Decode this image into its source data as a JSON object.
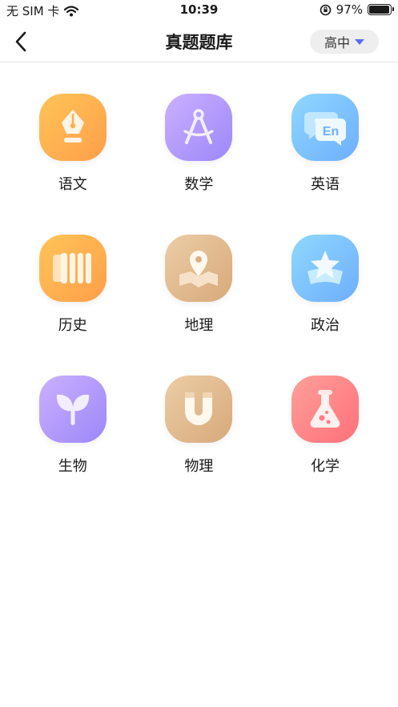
{
  "status_bar": {
    "carrier": "无 SIM 卡",
    "time": "10:39",
    "battery_text": "97%",
    "battery_level": 0.97
  },
  "nav": {
    "title": "真题题库",
    "grade": "高中",
    "accent_color": "#5b6bf0"
  },
  "subjects": [
    {
      "label": "语文",
      "icon": "fountain-pen-icon",
      "colors": [
        "#ffc457",
        "#ff9f4a"
      ]
    },
    {
      "label": "数学",
      "icon": "compass-icon",
      "colors": [
        "#cbb0ff",
        "#9c87f8"
      ]
    },
    {
      "label": "英语",
      "icon": "english-chat-icon",
      "colors": [
        "#8fd8ff",
        "#6eaefc"
      ]
    },
    {
      "label": "历史",
      "icon": "scroll-icon",
      "colors": [
        "#ffc457",
        "#ff9f4a"
      ]
    },
    {
      "label": "地理",
      "icon": "map-pin-icon",
      "colors": [
        "#eccda6",
        "#d7a97a"
      ]
    },
    {
      "label": "政治",
      "icon": "star-icon",
      "colors": [
        "#8fd8ff",
        "#6eaefc"
      ]
    },
    {
      "label": "生物",
      "icon": "sprout-icon",
      "colors": [
        "#cbb0ff",
        "#9c87f8"
      ]
    },
    {
      "label": "物理",
      "icon": "magnet-icon",
      "colors": [
        "#eccda6",
        "#d7a97a"
      ]
    },
    {
      "label": "化学",
      "icon": "flask-icon",
      "colors": [
        "#ffa09a",
        "#ff6f7a"
      ]
    }
  ]
}
